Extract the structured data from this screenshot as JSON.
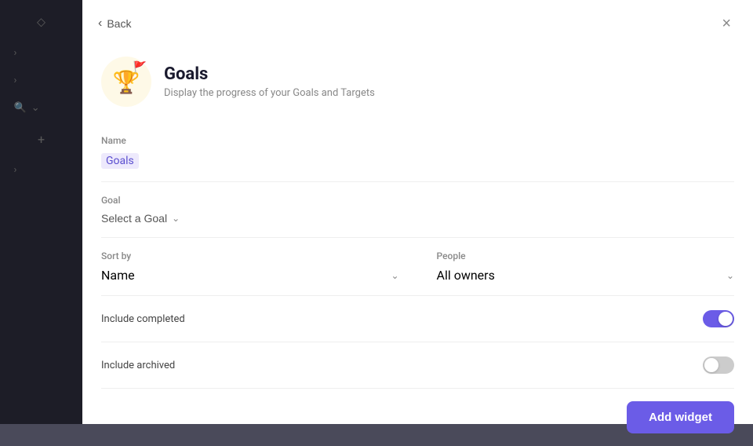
{
  "sidebar": {
    "icons": [
      "⬦",
      ">",
      ">",
      "🔍",
      "+",
      ">"
    ]
  },
  "modal": {
    "back_label": "Back",
    "close_label": "×",
    "widget": {
      "title": "Goals",
      "description": "Display the progress of your Goals and Targets"
    },
    "name_label": "Name",
    "name_value": "Goals",
    "goal_label": "Goal",
    "goal_placeholder": "Select a Goal",
    "sort_label": "Sort by",
    "sort_value": "Name",
    "people_label": "People",
    "people_value": "All owners",
    "include_completed_label": "Include completed",
    "include_completed_on": true,
    "include_archived_label": "Include archived",
    "include_archived_on": false,
    "add_button_label": "Add widget"
  }
}
